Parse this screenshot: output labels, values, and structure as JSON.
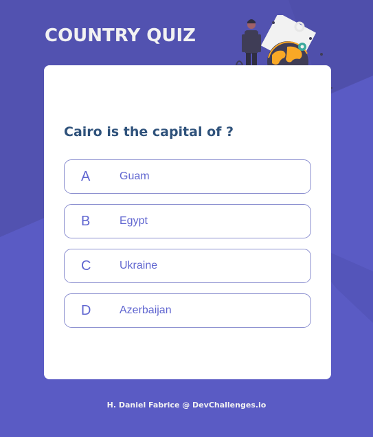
{
  "app": {
    "title": "COUNTRY QUIZ"
  },
  "quiz": {
    "question": "Cairo is the capital of ?",
    "options": [
      {
        "letter": "A",
        "answer": "Guam"
      },
      {
        "letter": "B",
        "answer": "Egypt"
      },
      {
        "letter": "C",
        "answer": "Ukraine"
      },
      {
        "letter": "D",
        "answer": "Azerbaijan"
      }
    ]
  },
  "footer": {
    "credit": "H. Daniel Fabrice @ DevChallenges.io"
  },
  "colors": {
    "background": "#5a5bc4",
    "title": "#f2f2f2",
    "question": "#2f527b",
    "option_text": "#6066d0",
    "option_border": "#8a8ecf",
    "illustration_accent": "#f9a826"
  },
  "icons": {
    "illustration": "traveler-globe-illustration"
  }
}
